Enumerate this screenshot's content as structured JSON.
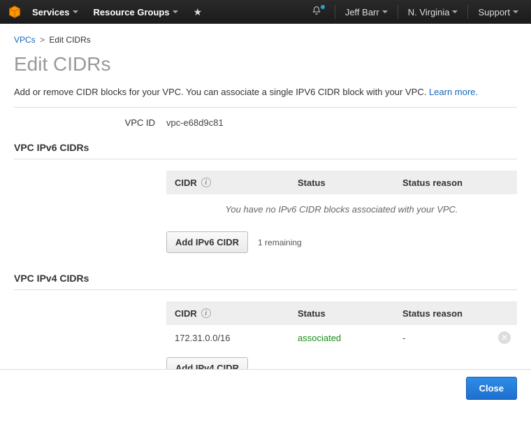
{
  "nav": {
    "services": "Services",
    "resource_groups": "Resource Groups",
    "user": "Jeff Barr",
    "region": "N. Virginia",
    "support": "Support"
  },
  "breadcrumb": {
    "root": "VPCs",
    "current": "Edit CIDRs"
  },
  "page_title": "Edit CIDRs",
  "description": {
    "text": "Add or remove CIDR blocks for your VPC. You can associate a single IPV6 CIDR block with your VPC. ",
    "link": "Learn more."
  },
  "vpc": {
    "label": "VPC ID",
    "id": "vpc-e68d9c81"
  },
  "columns": {
    "cidr": "CIDR",
    "status": "Status",
    "reason": "Status reason"
  },
  "ipv6": {
    "section_title": "VPC IPv6 CIDRs",
    "empty": "You have no IPv6 CIDR blocks associated with your VPC.",
    "add_button": "Add IPv6 CIDR",
    "remaining": "1 remaining"
  },
  "ipv4": {
    "section_title": "VPC IPv4 CIDRs",
    "rows": [
      {
        "cidr": "172.31.0.0/16",
        "status": "associated",
        "reason": "-"
      }
    ],
    "add_button": "Add IPv4 CIDR"
  },
  "footer": {
    "close": "Close"
  }
}
